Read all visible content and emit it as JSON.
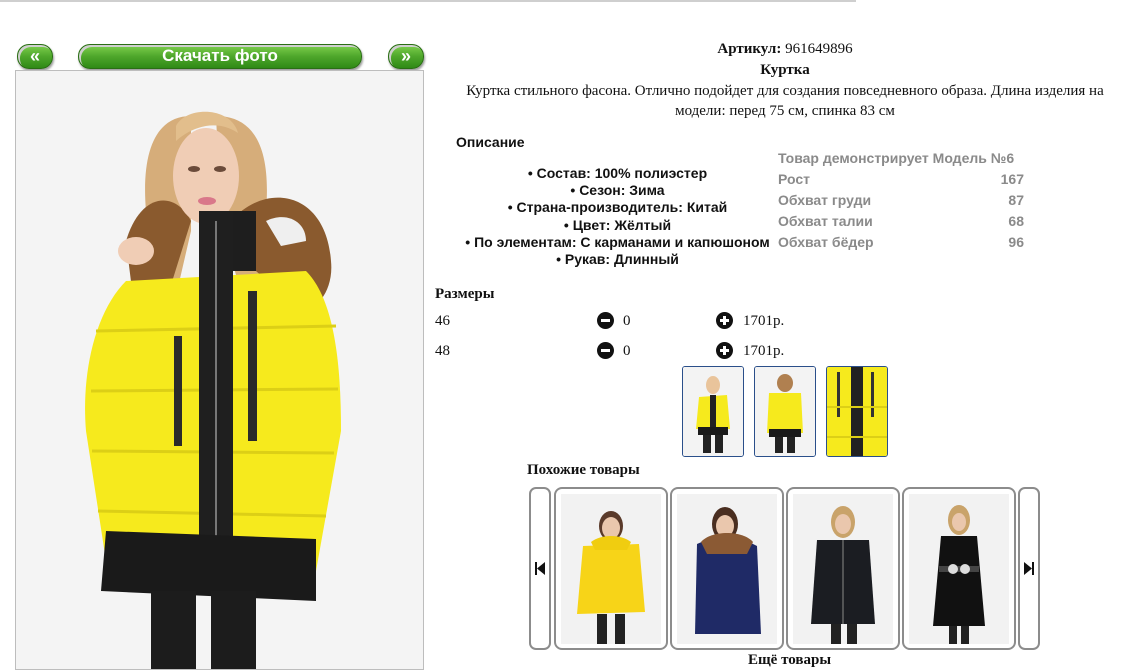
{
  "nav": {
    "prev_label": "«",
    "download_label": "Скачать фото",
    "next_label": "»"
  },
  "product": {
    "article_label": "Артикул:",
    "article_value": "961649896",
    "name": "Куртка",
    "description": "Куртка стильного фасона. Отлично подойдет для создания повседневного образа. Длина изделия на модели: перед 75 см, спинка 83 см"
  },
  "description_section": {
    "heading": "Описание",
    "specs": [
      "Состав: 100% полиэстер",
      "Сезон: Зима",
      "Страна-производитель: Китай",
      "Цвет: Жёлтый",
      "По элементам: С карманами и капюшоном",
      "Рукав: Длинный"
    ]
  },
  "model": {
    "title": "Товар демонстрирует Модель №6",
    "rows": [
      {
        "label": "Рост",
        "value": "167"
      },
      {
        "label": "Обхват груди",
        "value": "87"
      },
      {
        "label": "Обхват талии",
        "value": "68"
      },
      {
        "label": "Обхват бёдер",
        "value": "96"
      }
    ]
  },
  "sizes": {
    "heading": "Размеры",
    "rows": [
      {
        "size": "46",
        "qty": "0",
        "price": "1701р."
      },
      {
        "size": "48",
        "qty": "0",
        "price": "1701р."
      }
    ]
  },
  "similar": {
    "heading": "Похожие товары",
    "more_label": "Ещё товары"
  },
  "colors": {
    "accent_green": "#4ea62b",
    "jacket_yellow": "#f5e81c",
    "thumb_border": "#2a4f8a"
  }
}
